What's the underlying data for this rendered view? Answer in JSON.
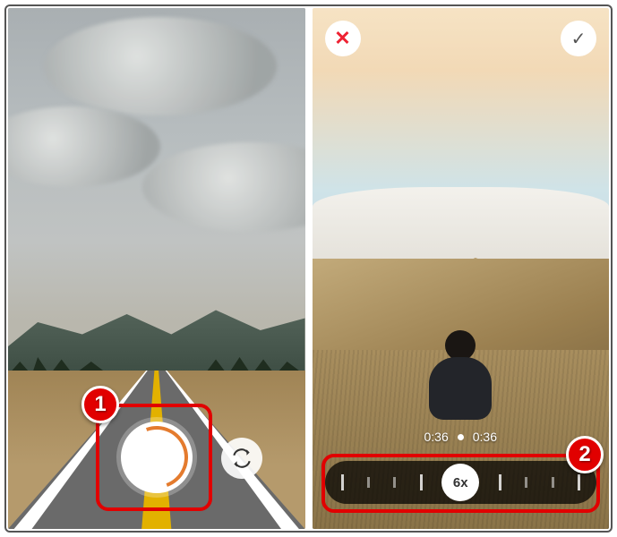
{
  "callouts": {
    "one": "1",
    "two": "2"
  },
  "left": {
    "record_label": "Record",
    "switch_label": "Switch camera"
  },
  "right": {
    "cancel_glyph": "✕",
    "accept_glyph": "✓",
    "time_start": "0:36",
    "time_end": "0:36",
    "speed_label": "6x"
  }
}
